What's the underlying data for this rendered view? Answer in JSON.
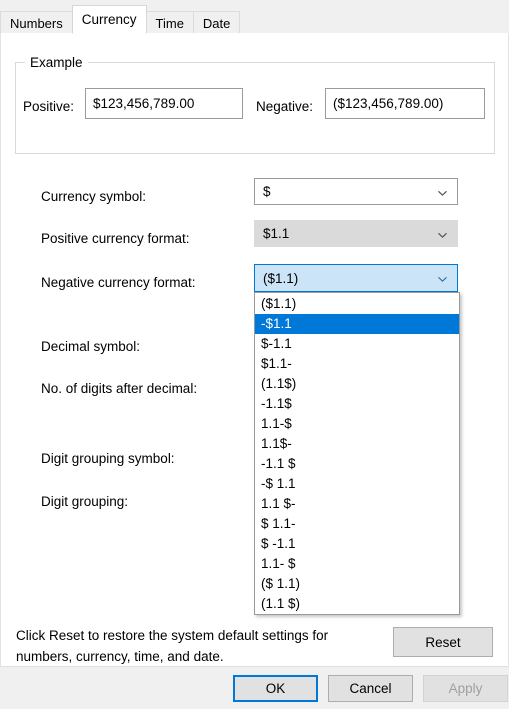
{
  "tabs": [
    {
      "label": "Numbers",
      "active": false
    },
    {
      "label": "Currency",
      "active": true
    },
    {
      "label": "Time",
      "active": false
    },
    {
      "label": "Date",
      "active": false
    }
  ],
  "example_group": {
    "legend": "Example",
    "positive_label": "Positive:",
    "positive_value": "$123,456,789.00",
    "negative_label": "Negative:",
    "negative_value": "($123,456,789.00)"
  },
  "fields": {
    "currency_symbol_label": "Currency symbol:",
    "currency_symbol_value": "$",
    "positive_format_label": "Positive currency format:",
    "positive_format_value": "$1.1",
    "negative_format_label": "Negative currency format:",
    "negative_format_value": "($1.1)",
    "decimal_symbol_label": "Decimal symbol:",
    "digits_after_decimal_label": "No. of digits after decimal:",
    "digit_grouping_symbol_label": "Digit grouping symbol:",
    "digit_grouping_label": "Digit grouping:"
  },
  "negative_format_options": [
    "($1.1)",
    "-$1.1",
    "$-1.1",
    "$1.1-",
    "(1.1$)",
    "-1.1$",
    "1.1-$",
    "1.1$-",
    "-1.1 $",
    "-$ 1.1",
    "1.1 $-",
    "$ 1.1-",
    "$ -1.1",
    "1.1- $",
    "($ 1.1)",
    "(1.1 $)"
  ],
  "negative_format_selected_index": 1,
  "reset": {
    "description_line1": "Click Reset to restore the system default settings for",
    "description_line2": "numbers, currency, time, and date.",
    "button_label": "Reset"
  },
  "footer": {
    "ok_label": "OK",
    "cancel_label": "Cancel",
    "apply_label": "Apply"
  },
  "colors": {
    "accent": "#0078d7",
    "selection": "#0078d7",
    "combo_open_fill": "#cce4f7",
    "combo_hover_fill": "#dadada",
    "dialog_bg": "#ffffff",
    "footer_bg": "#f0f0f0"
  }
}
